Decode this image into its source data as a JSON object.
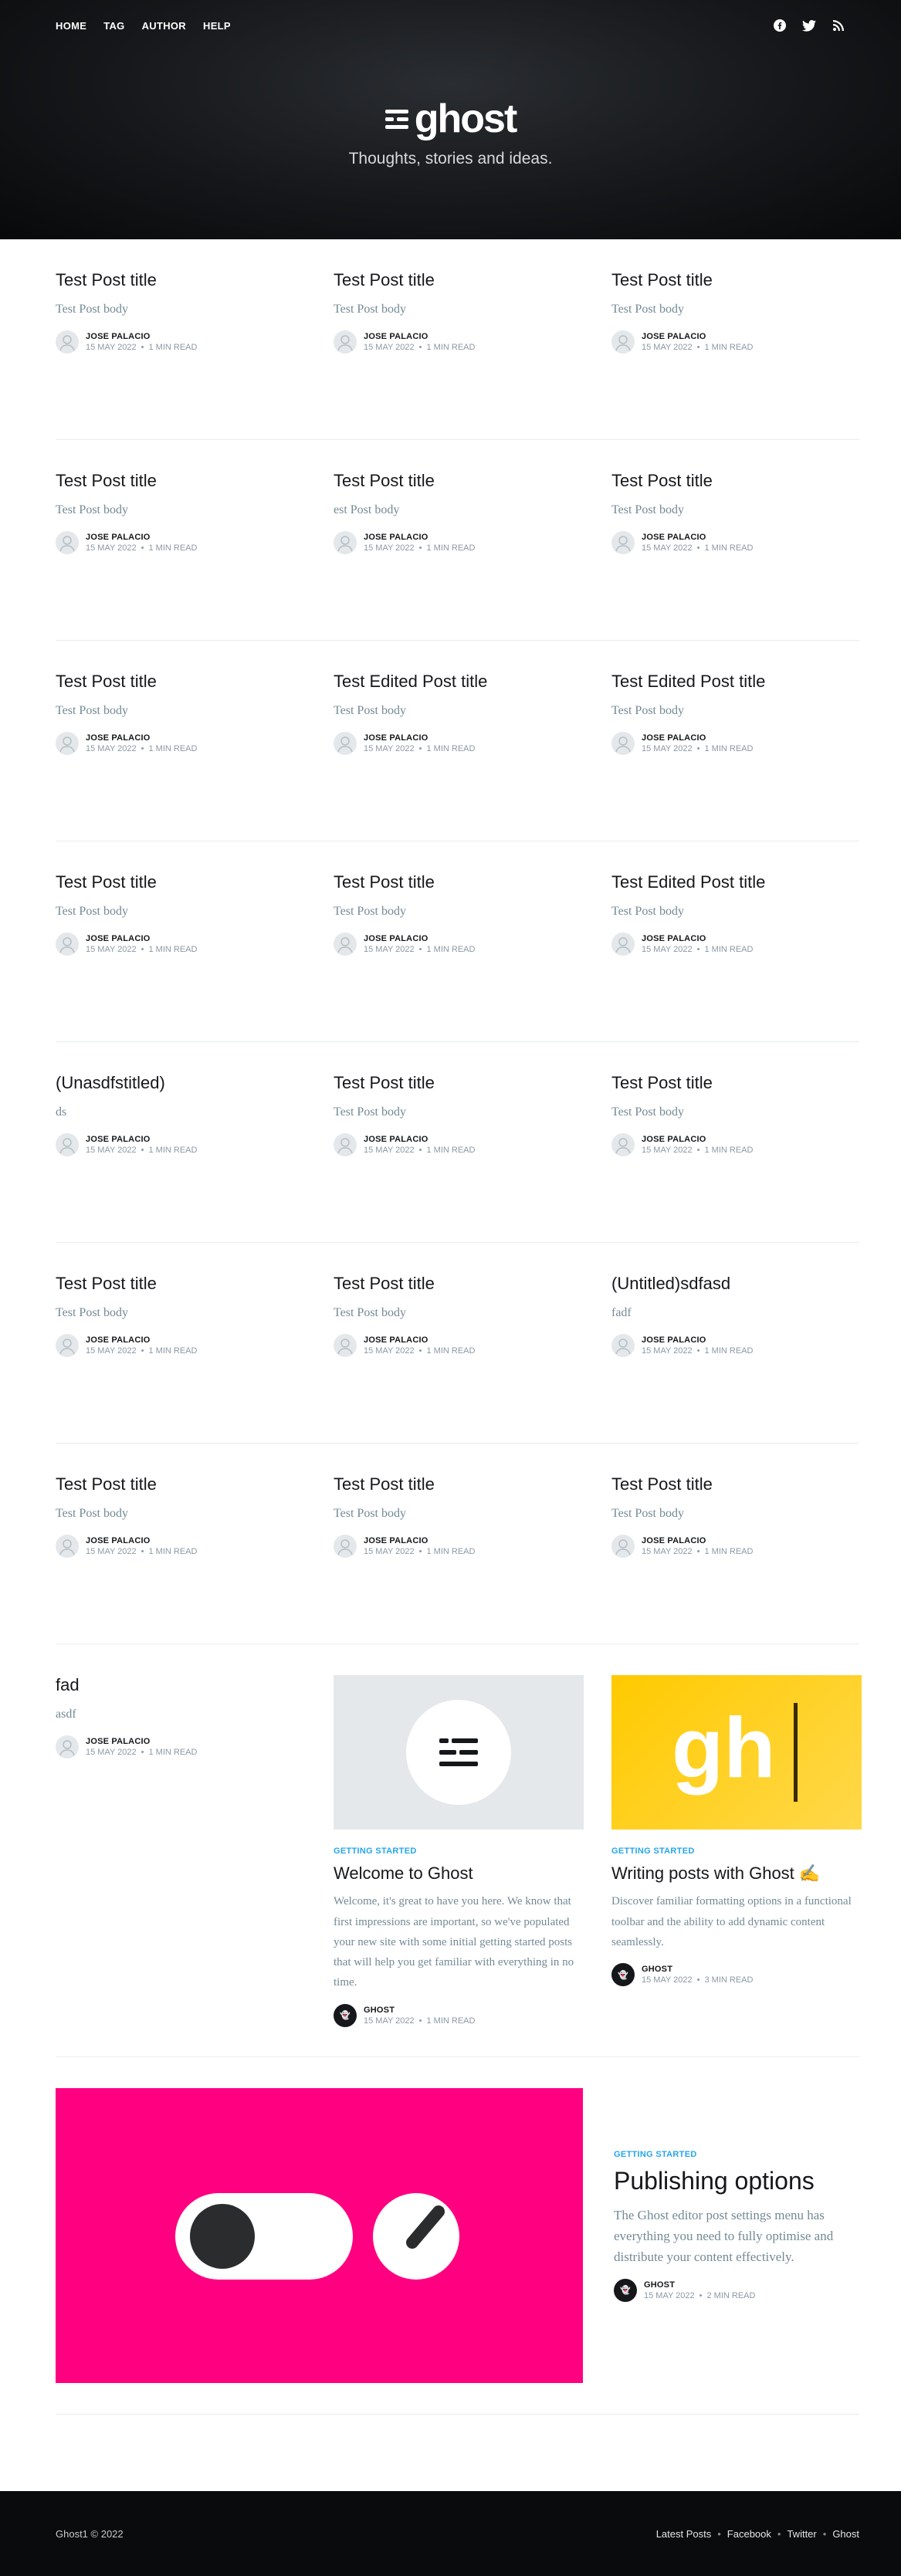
{
  "nav": {
    "links": [
      "HOME",
      "TAG",
      "AUTHOR",
      "HELP"
    ]
  },
  "social": [
    "facebook-icon",
    "twitter-icon",
    "rss-icon"
  ],
  "brand": {
    "logo_text": "ghost",
    "tagline": "Thoughts, stories and ideas."
  },
  "posts": [
    {
      "title": "Test Post title",
      "excerpt": "Test Post body",
      "author": "JOSE PALACIO",
      "date": "15 MAY 2022",
      "read": "1 MIN READ"
    },
    {
      "title": "Test Post title",
      "excerpt": "Test Post body",
      "author": "JOSE PALACIO",
      "date": "15 MAY 2022",
      "read": "1 MIN READ"
    },
    {
      "title": "Test Post title",
      "excerpt": "Test Post body",
      "author": "JOSE PALACIO",
      "date": "15 MAY 2022",
      "read": "1 MIN READ"
    },
    {
      "title": "Test Post title",
      "excerpt": "Test Post body",
      "author": "JOSE PALACIO",
      "date": "15 MAY 2022",
      "read": "1 MIN READ"
    },
    {
      "title": "Test Post title",
      "excerpt": "est Post body",
      "author": "JOSE PALACIO",
      "date": "15 MAY 2022",
      "read": "1 MIN READ"
    },
    {
      "title": "Test Post title",
      "excerpt": "Test Post body",
      "author": "JOSE PALACIO",
      "date": "15 MAY 2022",
      "read": "1 MIN READ"
    },
    {
      "title": "Test Post title",
      "excerpt": "Test Post body",
      "author": "JOSE PALACIO",
      "date": "15 MAY 2022",
      "read": "1 MIN READ"
    },
    {
      "title": "Test Edited Post title",
      "excerpt": "Test Post body",
      "author": "JOSE PALACIO",
      "date": "15 MAY 2022",
      "read": "1 MIN READ"
    },
    {
      "title": "Test Edited Post title",
      "excerpt": "Test Post body",
      "author": "JOSE PALACIO",
      "date": "15 MAY 2022",
      "read": "1 MIN READ"
    },
    {
      "title": "Test Post title",
      "excerpt": "Test Post body",
      "author": "JOSE PALACIO",
      "date": "15 MAY 2022",
      "read": "1 MIN READ"
    },
    {
      "title": "Test Post title",
      "excerpt": "Test Post body",
      "author": "JOSE PALACIO",
      "date": "15 MAY 2022",
      "read": "1 MIN READ"
    },
    {
      "title": "Test Edited Post title",
      "excerpt": "Test Post body",
      "author": "JOSE PALACIO",
      "date": "15 MAY 2022",
      "read": "1 MIN READ"
    },
    {
      "title": "(Unasdfstitled)",
      "excerpt": "ds",
      "author": "JOSE PALACIO",
      "date": "15 MAY 2022",
      "read": "1 MIN READ"
    },
    {
      "title": "Test Post title",
      "excerpt": "Test Post body",
      "author": "JOSE PALACIO",
      "date": "15 MAY 2022",
      "read": "1 MIN READ"
    },
    {
      "title": "Test Post title",
      "excerpt": "Test Post body",
      "author": "JOSE PALACIO",
      "date": "15 MAY 2022",
      "read": "1 MIN READ"
    },
    {
      "title": "Test Post title",
      "excerpt": "Test Post body",
      "author": "JOSE PALACIO",
      "date": "15 MAY 2022",
      "read": "1 MIN READ"
    },
    {
      "title": "Test Post title",
      "excerpt": "Test Post body",
      "author": "JOSE PALACIO",
      "date": "15 MAY 2022",
      "read": "1 MIN READ"
    },
    {
      "title": "(Untitled)sdfasd",
      "excerpt": "fadf",
      "author": "JOSE PALACIO",
      "date": "15 MAY 2022",
      "read": "1 MIN READ"
    },
    {
      "title": "Test Post title",
      "excerpt": "Test Post body",
      "author": "JOSE PALACIO",
      "date": "15 MAY 2022",
      "read": "1 MIN READ"
    },
    {
      "title": "Test Post title",
      "excerpt": "Test Post body",
      "author": "JOSE PALACIO",
      "date": "15 MAY 2022",
      "read": "1 MIN READ"
    },
    {
      "title": "Test Post title",
      "excerpt": "Test Post body",
      "author": "JOSE PALACIO",
      "date": "15 MAY 2022",
      "read": "1 MIN READ"
    }
  ],
  "feature": {
    "fad": {
      "title": "fad",
      "excerpt": "asdf",
      "author": "JOSE PALACIO",
      "date": "15 MAY 2022",
      "read": "1 MIN READ"
    },
    "welcome": {
      "tag": "GETTING STARTED",
      "title": "Welcome to Ghost",
      "excerpt": "Welcome, it's great to have you here. We know that first impressions are important, so we've populated your new site with some initial getting started posts that will help you get familiar with everything in no time.",
      "author": "GHOST",
      "date": "15 MAY 2022",
      "read": "1 MIN READ"
    },
    "writing": {
      "tag": "GETTING STARTED",
      "title": "Writing posts with Ghost ✍️",
      "excerpt": "Discover familiar formatting options in a functional toolbar and the ability to add dynamic content seamlessly.",
      "author": "GHOST",
      "date": "15 MAY 2022",
      "read": "3 MIN READ",
      "image_text": "gh"
    },
    "publishing": {
      "tag": "GETTING STARTED",
      "title": "Publishing options",
      "excerpt": "The Ghost editor post settings menu has everything you need to fully optimise and distribute your content effectively.",
      "author": "GHOST",
      "date": "15 MAY 2022",
      "read": "2 MIN READ"
    }
  },
  "footer": {
    "copy": "Ghost1 © 2022",
    "links": [
      "Latest Posts",
      "Facebook",
      "Twitter",
      "Ghost"
    ]
  },
  "colors": {
    "accent": "#26a6ed",
    "pink": "#ff0080",
    "yellow": "#ffca00",
    "dark": "#15171a"
  }
}
